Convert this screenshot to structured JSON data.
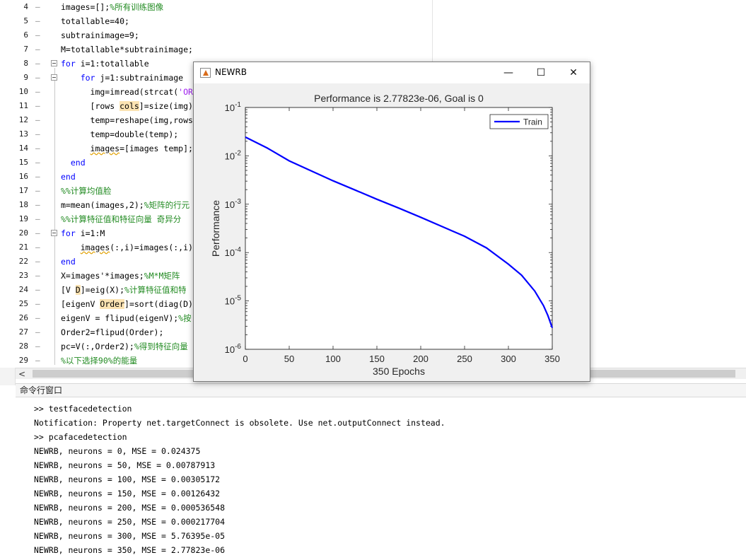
{
  "editor": {
    "lines": [
      {
        "num": "4",
        "parts": [
          {
            "t": "images=[];",
            "c": ""
          },
          {
            "t": "%所有训练图像",
            "c": "cm"
          }
        ]
      },
      {
        "num": "5",
        "parts": [
          {
            "t": "totallable=40;",
            "c": ""
          }
        ]
      },
      {
        "num": "6",
        "parts": [
          {
            "t": "subtrainimage=9;",
            "c": ""
          }
        ]
      },
      {
        "num": "7",
        "parts": [
          {
            "t": "M=totallable*subtrainimage;",
            "c": ""
          }
        ]
      },
      {
        "num": "8",
        "fold": true,
        "parts": [
          {
            "t": "for",
            "c": "kw"
          },
          {
            "t": " i=1:totallable",
            "c": ""
          }
        ]
      },
      {
        "num": "9",
        "fold": true,
        "parts": [
          {
            "t": "    ",
            "c": ""
          },
          {
            "t": "for",
            "c": "kw"
          },
          {
            "t": " j=1:subtrainimage",
            "c": ""
          }
        ]
      },
      {
        "num": "10",
        "parts": [
          {
            "t": "      img=imread(strcat(",
            "c": ""
          },
          {
            "t": "'ORL",
            "c": "str"
          }
        ]
      },
      {
        "num": "11",
        "parts": [
          {
            "t": "      [rows ",
            "c": ""
          },
          {
            "t": "cols",
            "c": "hl"
          },
          {
            "t": "]=size(img);",
            "c": ""
          }
        ]
      },
      {
        "num": "12",
        "parts": [
          {
            "t": "      temp=reshape(img,rows*",
            "c": ""
          }
        ]
      },
      {
        "num": "13",
        "parts": [
          {
            "t": "      temp=double(temp);",
            "c": ""
          }
        ]
      },
      {
        "num": "14",
        "parts": [
          {
            "t": "      ",
            "c": ""
          },
          {
            "t": "images",
            "c": "ul"
          },
          {
            "t": "=[images temp];",
            "c": ""
          }
        ]
      },
      {
        "num": "15",
        "parts": [
          {
            "t": "  ",
            "c": ""
          },
          {
            "t": "end",
            "c": "kw"
          }
        ]
      },
      {
        "num": "16",
        "parts": [
          {
            "t": "end",
            "c": "kw"
          }
        ]
      },
      {
        "num": "17",
        "parts": [
          {
            "t": "%%计算均值脸",
            "c": "cm"
          }
        ]
      },
      {
        "num": "18",
        "parts": [
          {
            "t": "m=mean(images,2);",
            "c": ""
          },
          {
            "t": "%矩阵的行元",
            "c": "cm"
          }
        ]
      },
      {
        "num": "19",
        "parts": [
          {
            "t": "%%计算特征值和特征向量 奇异分",
            "c": "cm"
          }
        ]
      },
      {
        "num": "20",
        "fold": true,
        "parts": [
          {
            "t": "for",
            "c": "kw"
          },
          {
            "t": " i=1:M",
            "c": ""
          }
        ]
      },
      {
        "num": "21",
        "parts": [
          {
            "t": "    ",
            "c": ""
          },
          {
            "t": "images",
            "c": "ul"
          },
          {
            "t": "(:,i)=images(:,i)",
            "c": ""
          }
        ]
      },
      {
        "num": "22",
        "parts": [
          {
            "t": "end",
            "c": "kw"
          }
        ]
      },
      {
        "num": "23",
        "parts": [
          {
            "t": "X=images'*images;",
            "c": ""
          },
          {
            "t": "%M*M矩阵",
            "c": "cm"
          }
        ]
      },
      {
        "num": "24",
        "parts": [
          {
            "t": "[V ",
            "c": ""
          },
          {
            "t": "D",
            "c": "hl"
          },
          {
            "t": "]=eig(X);",
            "c": ""
          },
          {
            "t": "%计算特征值和特",
            "c": "cm"
          }
        ]
      },
      {
        "num": "25",
        "parts": [
          {
            "t": "[eigenV ",
            "c": ""
          },
          {
            "t": "Order",
            "c": "hl"
          },
          {
            "t": "]=sort(diag(D))",
            "c": ""
          }
        ]
      },
      {
        "num": "26",
        "parts": [
          {
            "t": "eigenV = flipud(eigenV);",
            "c": ""
          },
          {
            "t": "%按",
            "c": "cm"
          }
        ]
      },
      {
        "num": "27",
        "parts": [
          {
            "t": "Order2=flipud(Order);",
            "c": ""
          }
        ]
      },
      {
        "num": "28",
        "parts": [
          {
            "t": "pc=V(:,Order2);",
            "c": ""
          },
          {
            "t": "%得到特征向量",
            "c": "cm"
          }
        ]
      },
      {
        "num": "29",
        "parts": [
          {
            "t": "%以下选择90%的能量",
            "c": "cm"
          }
        ]
      }
    ]
  },
  "scrollbar": {
    "left_arrow": "<"
  },
  "command_window": {
    "title": "命令行窗口",
    "lines": [
      ">> testfacedetection",
      "Notification: Property net.targetConnect is obsolete. Use net.outputConnect instead.",
      ">> pcafacedetection",
      "NEWRB, neurons = 0, MSE = 0.024375",
      "NEWRB, neurons = 50, MSE = 0.00787913",
      "NEWRB, neurons = 100, MSE = 0.00305172",
      "NEWRB, neurons = 150, MSE = 0.00126432",
      "NEWRB, neurons = 200, MSE = 0.000536548",
      "NEWRB, neurons = 250, MSE = 0.000217704",
      "NEWRB, neurons = 300, MSE = 5.76395e-05",
      "NEWRB, neurons = 350, MSE = 2.77823e-06"
    ]
  },
  "figure": {
    "title": "NEWRB",
    "minimize": "—",
    "maximize": "☐",
    "close": "✕"
  },
  "chart_data": {
    "type": "line",
    "title": "Performance is 2.77823e-06, Goal is 0",
    "xlabel": "350 Epochs",
    "ylabel": "Performance",
    "xlim": [
      0,
      350
    ],
    "ylim": [
      1e-06,
      0.1
    ],
    "yscale": "log",
    "xticks": [
      "0",
      "50",
      "100",
      "150",
      "200",
      "250",
      "300",
      "350"
    ],
    "xtick_values": [
      0,
      50,
      100,
      150,
      200,
      250,
      300,
      350
    ],
    "ytick_exponents": [
      -1,
      -2,
      -3,
      -4,
      -5,
      -6
    ],
    "legend": {
      "position": "top-right",
      "entries": [
        "Train"
      ]
    },
    "series": [
      {
        "name": "Train",
        "color": "#0000ff",
        "x": [
          0,
          25,
          50,
          75,
          100,
          125,
          150,
          175,
          200,
          225,
          250,
          275,
          300,
          315,
          330,
          340,
          345,
          350
        ],
        "y": [
          0.024375,
          0.0145,
          0.00787913,
          0.0049,
          0.00305172,
          0.00197,
          0.00126432,
          0.00083,
          0.000536548,
          0.00034,
          0.000217704,
          0.000125,
          5.76395e-05,
          3.4e-05,
          1.6e-05,
          8e-06,
          5e-06,
          2.77823e-06
        ]
      }
    ]
  }
}
